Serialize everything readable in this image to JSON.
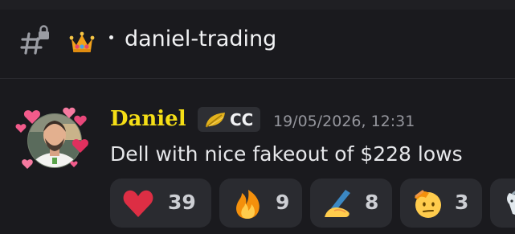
{
  "header": {
    "channel_name": "daniel-trading",
    "channel_icon": "locked-hash-icon",
    "category_icon": "crown-icon"
  },
  "message": {
    "author": "Daniel",
    "author_color": "#f5de16",
    "tag": {
      "icon": "leaf-icon",
      "text": "CC"
    },
    "timestamp": "19/05/2026, 12:31",
    "text": "Dell with nice fakeout of $228 lows",
    "avatar_icon": "avatar-with-hearts"
  },
  "reactions": [
    {
      "emoji": "red-heart-icon",
      "count": "39"
    },
    {
      "emoji": "fire-icon",
      "count": "9"
    },
    {
      "emoji": "writing-hand-icon",
      "count": "8"
    },
    {
      "emoji": "saluting-face-icon",
      "count": "3"
    },
    {
      "emoji": "goat-icon",
      "count": ""
    }
  ],
  "colors": {
    "background": "#1a1a1e",
    "reaction_bg": "#2a2b30",
    "text": "#e6e7ea",
    "muted": "#94959c"
  }
}
